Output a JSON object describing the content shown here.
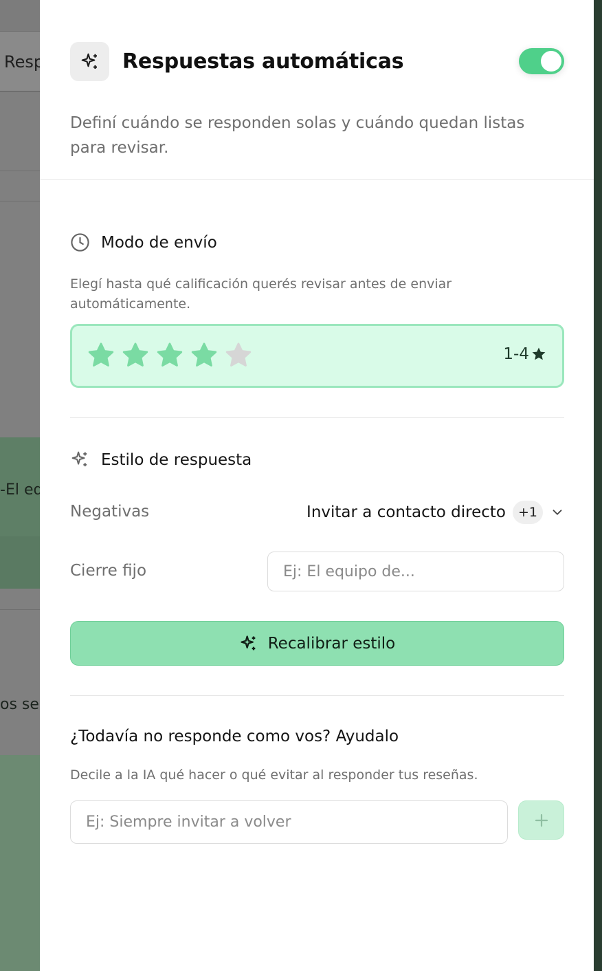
{
  "background": {
    "header_fragment": "Resp",
    "row_fragment_1": "-El eq",
    "row_fragment_2": "os se"
  },
  "panel": {
    "title": "Respuestas automáticas",
    "title_icon": "sparkles-icon",
    "enabled": true,
    "description": "Definí cuándo se responden solas y cuándo quedan listas para revisar."
  },
  "send_mode": {
    "title": "Modo de envío",
    "icon": "clock-icon",
    "hint": "Elegí hasta qué calificación querés revisar antes de enviar automáticamente.",
    "rating_selected": 4,
    "rating_max": 5,
    "range_label": "1-4",
    "colors": {
      "active_star": "#7adba3",
      "inactive_star": "#d6d6d6",
      "box_bg": "#d9fbe8",
      "box_border": "#9be7bd"
    }
  },
  "style": {
    "title": "Estilo de respuesta",
    "icon": "sparkles-icon",
    "negatives_label": "Negativas",
    "negatives_value": "Invitar a contacto directo",
    "negatives_extra": "+1",
    "closing_label": "Cierre fijo",
    "closing_placeholder": "Ej: El equipo de...",
    "closing_value": "",
    "recalibrate_label": "Recalibrar estilo"
  },
  "help": {
    "title": "¿Todavía no responde como vos? Ayudalo",
    "hint": "Decile a la IA qué hacer o qué evitar al responder tus reseñas.",
    "input_placeholder": "Ej: Siempre invitar a volver",
    "input_value": "",
    "add_icon": "plus-icon"
  },
  "colors": {
    "accent": "#4fd08a",
    "button_bg": "#8ee0b1"
  }
}
